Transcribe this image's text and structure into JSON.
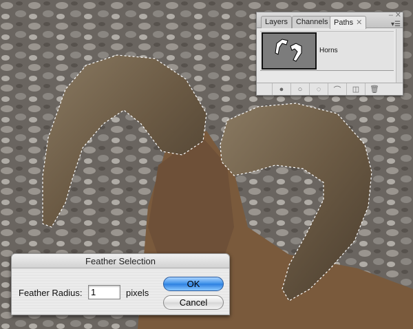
{
  "canvas": {
    "description_icon": "photo-canvas"
  },
  "paths_panel": {
    "tabs": [
      {
        "label": "Layers"
      },
      {
        "label": "Channels"
      },
      {
        "label": "Paths",
        "active": true
      }
    ],
    "paths": [
      {
        "name": "Horns"
      }
    ],
    "footer_icons": [
      "fill-path-icon",
      "stroke-path-icon",
      "load-selection-icon",
      "make-work-path-icon",
      "new-path-icon",
      "trash-icon"
    ]
  },
  "dialog": {
    "title": "Feather Selection",
    "radius_label": "Feather Radius:",
    "radius_value": "1",
    "unit": "pixels",
    "ok_label": "OK",
    "cancel_label": "Cancel"
  },
  "colors": {
    "ok_blue": "#3b8fe8",
    "thumb_gray": "#7c7c7c"
  }
}
